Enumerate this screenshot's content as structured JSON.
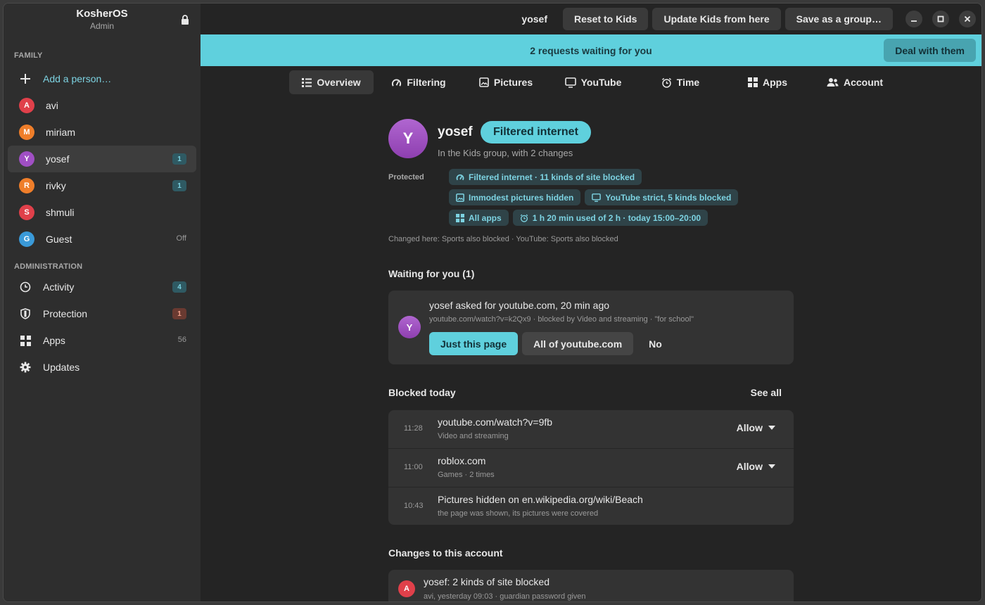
{
  "app": {
    "title": "KosherOS",
    "subtitle": "Admin"
  },
  "sidebar": {
    "family_heading": "FAMILY",
    "add_person": "Add a person…",
    "people": [
      {
        "initial": "A",
        "name": "avi",
        "color": "#e0404a",
        "badge": ""
      },
      {
        "initial": "M",
        "name": "miriam",
        "color": "#ef7e2a",
        "badge": ""
      },
      {
        "initial": "Y",
        "name": "yosef",
        "color": "#a04fc4",
        "badge": "1"
      },
      {
        "initial": "R",
        "name": "rivky",
        "color": "#ef7e2a",
        "badge": "1"
      },
      {
        "initial": "S",
        "name": "shmuli",
        "color": "#e0404a",
        "badge": ""
      },
      {
        "initial": "G",
        "name": "Guest",
        "color": "#3a9ad9",
        "trail": "Off"
      }
    ],
    "admin_heading": "ADMINISTRATION",
    "admin_items": [
      {
        "label": "Activity",
        "badge": "4"
      },
      {
        "label": "Protection",
        "badge": "1"
      },
      {
        "label": "Apps",
        "count": "56"
      },
      {
        "label": "Updates"
      }
    ]
  },
  "topbar": {
    "user": "yosef",
    "reset": "Reset to Kids",
    "update": "Update Kids from here",
    "save": "Save as a group…"
  },
  "banner": {
    "text": "2 requests waiting for you",
    "button": "Deal with them"
  },
  "tabs": [
    "Overview",
    "Filtering",
    "Pictures",
    "YouTube",
    "Time",
    "Apps",
    "Account"
  ],
  "profile": {
    "initial": "Y",
    "name": "yosef",
    "pill": "Filtered internet",
    "subtitle": "In the Kids group, with 2 changes",
    "protected_label": "Protected",
    "chips": [
      "Filtered internet · 11 kinds of site blocked",
      "Immodest pictures hidden",
      "YouTube strict, 5 kinds blocked",
      "All apps",
      "1 h 20 min used of 2 h · today 15:00–20:00"
    ],
    "changed": "Changed here: Sports also blocked · YouTube: Sports also blocked"
  },
  "waiting": {
    "heading": "Waiting for you (1)",
    "initial": "Y",
    "title": "yosef asked for youtube.com, 20 min ago",
    "detail": "youtube.com/watch?v=k2Qx9 · blocked by Video and streaming · \"for school\"",
    "just_page": "Just this page",
    "all_site": "All of youtube.com",
    "no": "No"
  },
  "blocked": {
    "heading": "Blocked today",
    "see_all": "See all",
    "rows": [
      {
        "time": "11:28",
        "main": "youtube.com/watch?v=9fb",
        "sub": "Video and streaming",
        "action": "Allow"
      },
      {
        "time": "11:00",
        "main": "roblox.com",
        "sub": "Games · 2 times",
        "action": "Allow"
      },
      {
        "time": "10:43",
        "main": "Pictures hidden on en.wikipedia.org/wiki/Beach",
        "sub": "the page was shown, its pictures were covered"
      }
    ]
  },
  "changes": {
    "heading": "Changes to this account",
    "initial": "A",
    "title": "yosef: 2 kinds of site blocked",
    "sub": "avi, yesterday 09:03 · guardian password given"
  }
}
